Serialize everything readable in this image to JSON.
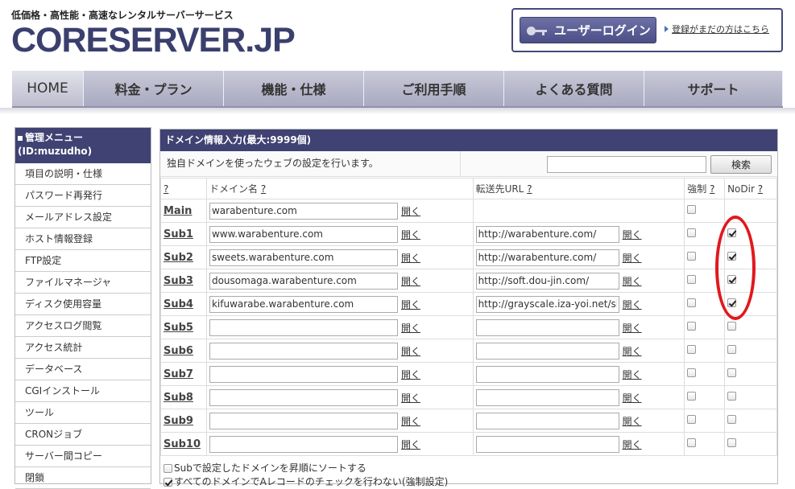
{
  "header": {
    "tagline": "低価格・高性能・高速なレンタルサーバーサービス",
    "logo": "CORESERVER.JP",
    "login_label": "ユーザーログイン",
    "register_link": "登録がまだの方はこちら"
  },
  "nav": [
    "HOME",
    "料金・プラン",
    "機能・仕様",
    "ご利用手順",
    "よくある質問",
    "サポート"
  ],
  "sidebar": {
    "title": "管理メニュー",
    "user": "(ID:muzudho)",
    "items": [
      "項目の説明・仕様",
      "パスワード再発行",
      "メールアドレス設定",
      "ホスト情報登録",
      "FTP設定",
      "ファイルマネージャ",
      "ディスク使用容量",
      "アクセスログ閲覧",
      "アクセス統計",
      "データベース",
      "CGIインストール",
      "ツール",
      "CRONジョブ",
      "サーバー間コピー",
      "閉鎖"
    ]
  },
  "panel": {
    "title": "ドメイン情報入力(最大:9999個)",
    "description": "独自ドメインを使ったウェブの設定を行います。",
    "search_value": "",
    "search_button": "検索",
    "columns": {
      "help": "?",
      "domain": "ドメイン名",
      "forward": "転送先URL",
      "force": "強制",
      "nodir": "NoDir"
    },
    "open_label": "開く",
    "rows": [
      {
        "label": "Main",
        "domain": "warabenture.com",
        "forward": null,
        "force": false,
        "nodir": null
      },
      {
        "label": "Sub1",
        "domain": "www.warabenture.com",
        "forward": "http://warabenture.com/",
        "force": false,
        "nodir": true
      },
      {
        "label": "Sub2",
        "domain": "sweets.warabenture.com",
        "forward": "http://warabenture.com/",
        "force": false,
        "nodir": true
      },
      {
        "label": "Sub3",
        "domain": "dousomaga.warabenture.com",
        "forward": "http://soft.dou-jin.com/",
        "force": false,
        "nodir": true
      },
      {
        "label": "Sub4",
        "domain": "kifuwarabe.warabenture.com",
        "forward": "http://grayscale.iza-yoi.net/sl",
        "force": false,
        "nodir": true
      },
      {
        "label": "Sub5",
        "domain": "",
        "forward": "",
        "force": false,
        "nodir": false
      },
      {
        "label": "Sub6",
        "domain": "",
        "forward": "",
        "force": false,
        "nodir": false
      },
      {
        "label": "Sub7",
        "domain": "",
        "forward": "",
        "force": false,
        "nodir": false
      },
      {
        "label": "Sub8",
        "domain": "",
        "forward": "",
        "force": false,
        "nodir": false
      },
      {
        "label": "Sub9",
        "domain": "",
        "forward": "",
        "force": false,
        "nodir": false
      },
      {
        "label": "Sub10",
        "domain": "",
        "forward": "",
        "force": false,
        "nodir": false
      }
    ],
    "options": [
      {
        "label": "Subで設定したドメインを昇順にソートする",
        "checked": false
      },
      {
        "label": "すべてのドメインでAレコードのチェックを行わない(強制設定)",
        "checked": true
      }
    ]
  },
  "colors": {
    "brand": "#3a3f6e",
    "header_bar": "#3f4272",
    "annotation": "#e0191e"
  }
}
